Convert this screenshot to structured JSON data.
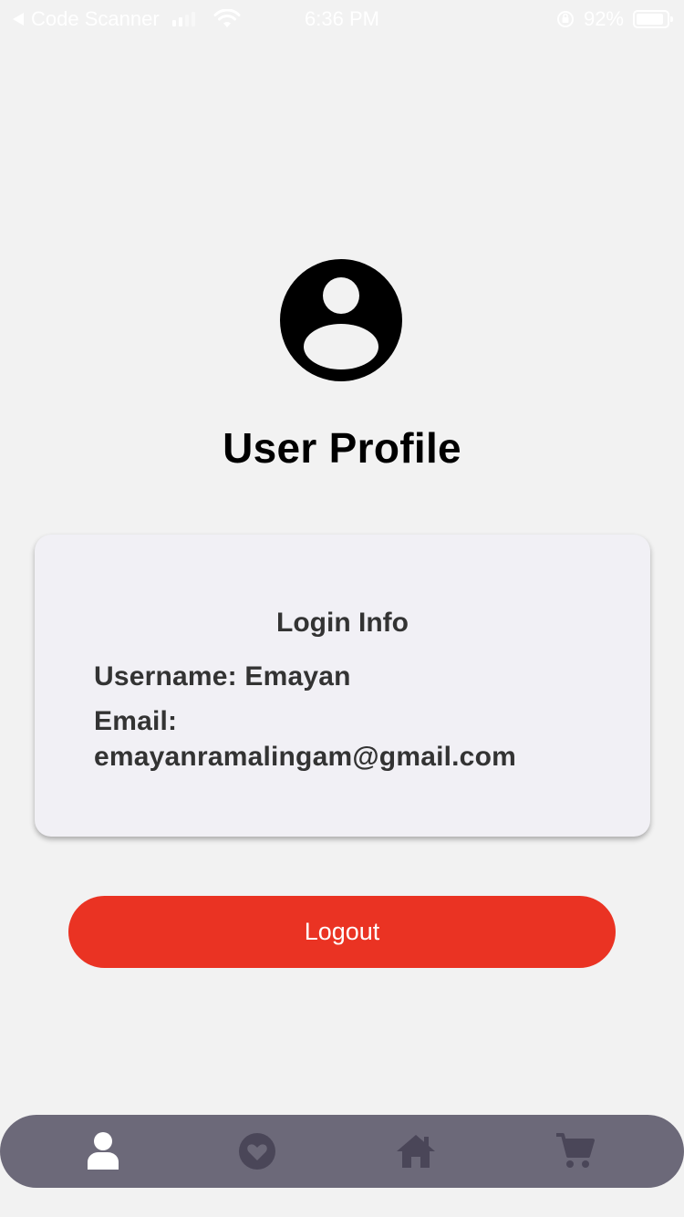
{
  "status_bar": {
    "back_app": "Code Scanner",
    "time": "6:36 PM",
    "battery": "92%",
    "battery_level": 0.92
  },
  "profile": {
    "avatar_icon": "user-circle-icon",
    "title": "User Profile"
  },
  "login_info": {
    "title": "Login Info",
    "username_line": "Username: Emayan",
    "email_label": "Email:",
    "email_value": "emayanramalingam@gmail.com"
  },
  "actions": {
    "logout_label": "Logout"
  },
  "tab_bar": {
    "items": [
      {
        "name": "profile",
        "icon": "person-icon",
        "active": true
      },
      {
        "name": "favorites",
        "icon": "heart-circle-icon",
        "active": false
      },
      {
        "name": "home",
        "icon": "home-icon",
        "active": false
      },
      {
        "name": "cart",
        "icon": "cart-icon",
        "active": false
      }
    ]
  },
  "colors": {
    "background": "#f2f2f2",
    "card": "#f1f0f5",
    "logout": "#ea3323",
    "tab_bar": "#6c6979",
    "tab_active": "#ffffff",
    "tab_inactive": "#4a4658"
  }
}
